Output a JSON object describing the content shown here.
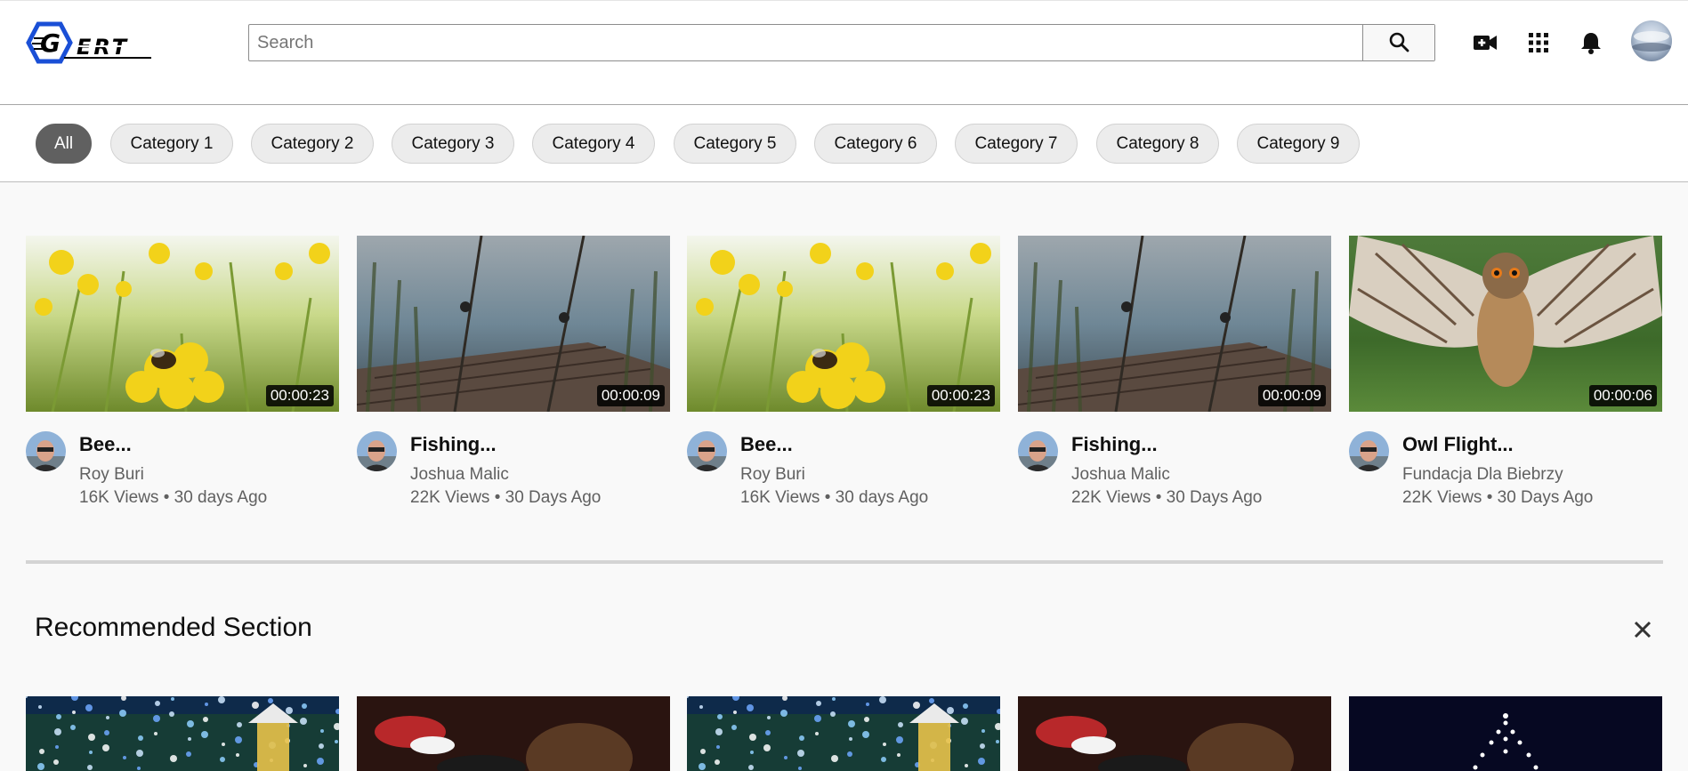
{
  "header": {
    "logo_text": "GERT",
    "search_placeholder": "Search",
    "search_value": "",
    "icons": [
      "video-camera-add-icon",
      "apps-grid-icon",
      "bell-icon"
    ]
  },
  "chips": [
    {
      "label": "All",
      "active": true
    },
    {
      "label": "Category 1",
      "active": false
    },
    {
      "label": "Category 2",
      "active": false
    },
    {
      "label": "Category 3",
      "active": false
    },
    {
      "label": "Category 4",
      "active": false
    },
    {
      "label": "Category 5",
      "active": false
    },
    {
      "label": "Category 6",
      "active": false
    },
    {
      "label": "Category 7",
      "active": false
    },
    {
      "label": "Category 8",
      "active": false
    },
    {
      "label": "Category 9",
      "active": false
    }
  ],
  "videos": [
    {
      "title": "Bee...",
      "channel": "Roy Buri",
      "meta": "16K Views • 30 days Ago",
      "duration": "00:00:23",
      "thumb": "bee-flower"
    },
    {
      "title": "Fishing...",
      "channel": "Joshua Malic",
      "meta": "22K Views • 30 Days Ago",
      "duration": "00:00:09",
      "thumb": "fishing-rods"
    },
    {
      "title": "Bee...",
      "channel": "Roy Buri",
      "meta": "16K Views • 30 days Ago",
      "duration": "00:00:23",
      "thumb": "bee-flower"
    },
    {
      "title": "Fishing...",
      "channel": "Joshua Malic",
      "meta": "22K Views • 30 Days Ago",
      "duration": "00:00:09",
      "thumb": "fishing-rods"
    },
    {
      "title": "Owl Flight...",
      "channel": "Fundacja Dla Biebrzy",
      "meta": "22K Views • 30 Days Ago",
      "duration": "00:00:06",
      "thumb": "owl-flight"
    }
  ],
  "recommended": {
    "title": "Recommended Section",
    "close_icon": "close-icon",
    "thumbs": [
      "christmas-lights-lantern",
      "teddy-bear-santa",
      "christmas-lights-lantern",
      "teddy-bear-santa",
      "christmas-tree-stars"
    ]
  }
}
